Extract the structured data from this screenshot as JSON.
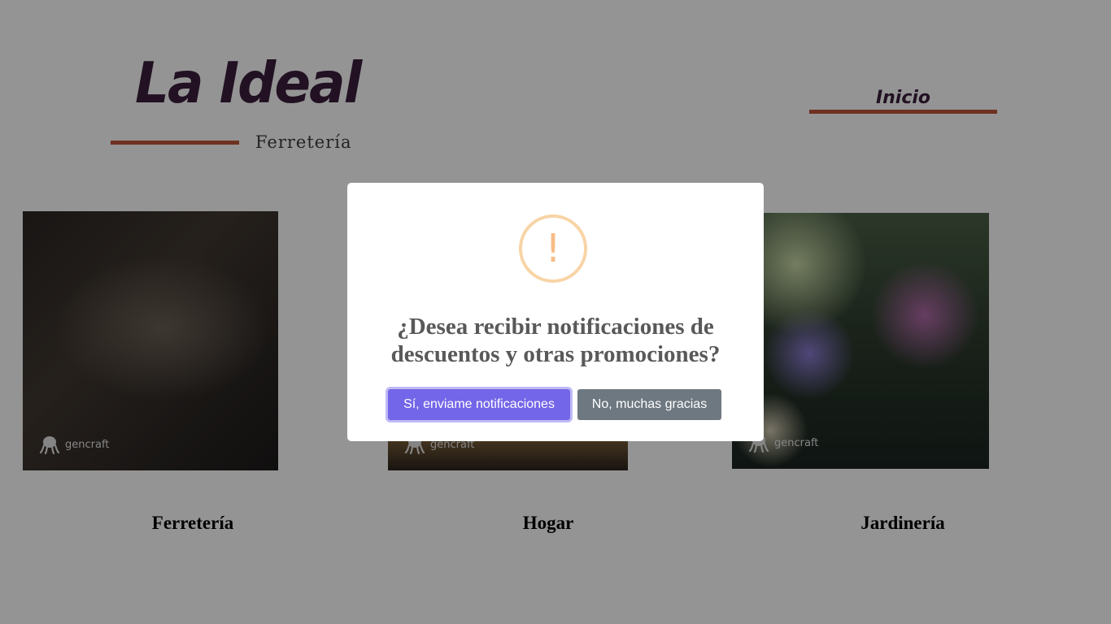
{
  "header": {
    "logo_title": "La Ideal",
    "logo_subtitle": "Ferretería",
    "nav_link": "Inicio"
  },
  "categories": [
    {
      "label": "Ferretería",
      "watermark": "gencraft"
    },
    {
      "label": "Hogar",
      "watermark": "gencraft"
    },
    {
      "label": "Jardinería",
      "watermark": "gencraft"
    }
  ],
  "dialog": {
    "icon": "warning-icon",
    "icon_glyph": "!",
    "title": "¿Desea recibir notificaciones de descuentos y otras promociones?",
    "confirm_label": "Sí, enviame notificaciones",
    "cancel_label": "No, muchas gracias"
  },
  "colors": {
    "brand_dark": "#3a1e3c",
    "brand_accent": "#c0553a",
    "confirm_button": "#7466e8",
    "cancel_button": "#6e7881",
    "warning_icon": "#f8bb86"
  }
}
